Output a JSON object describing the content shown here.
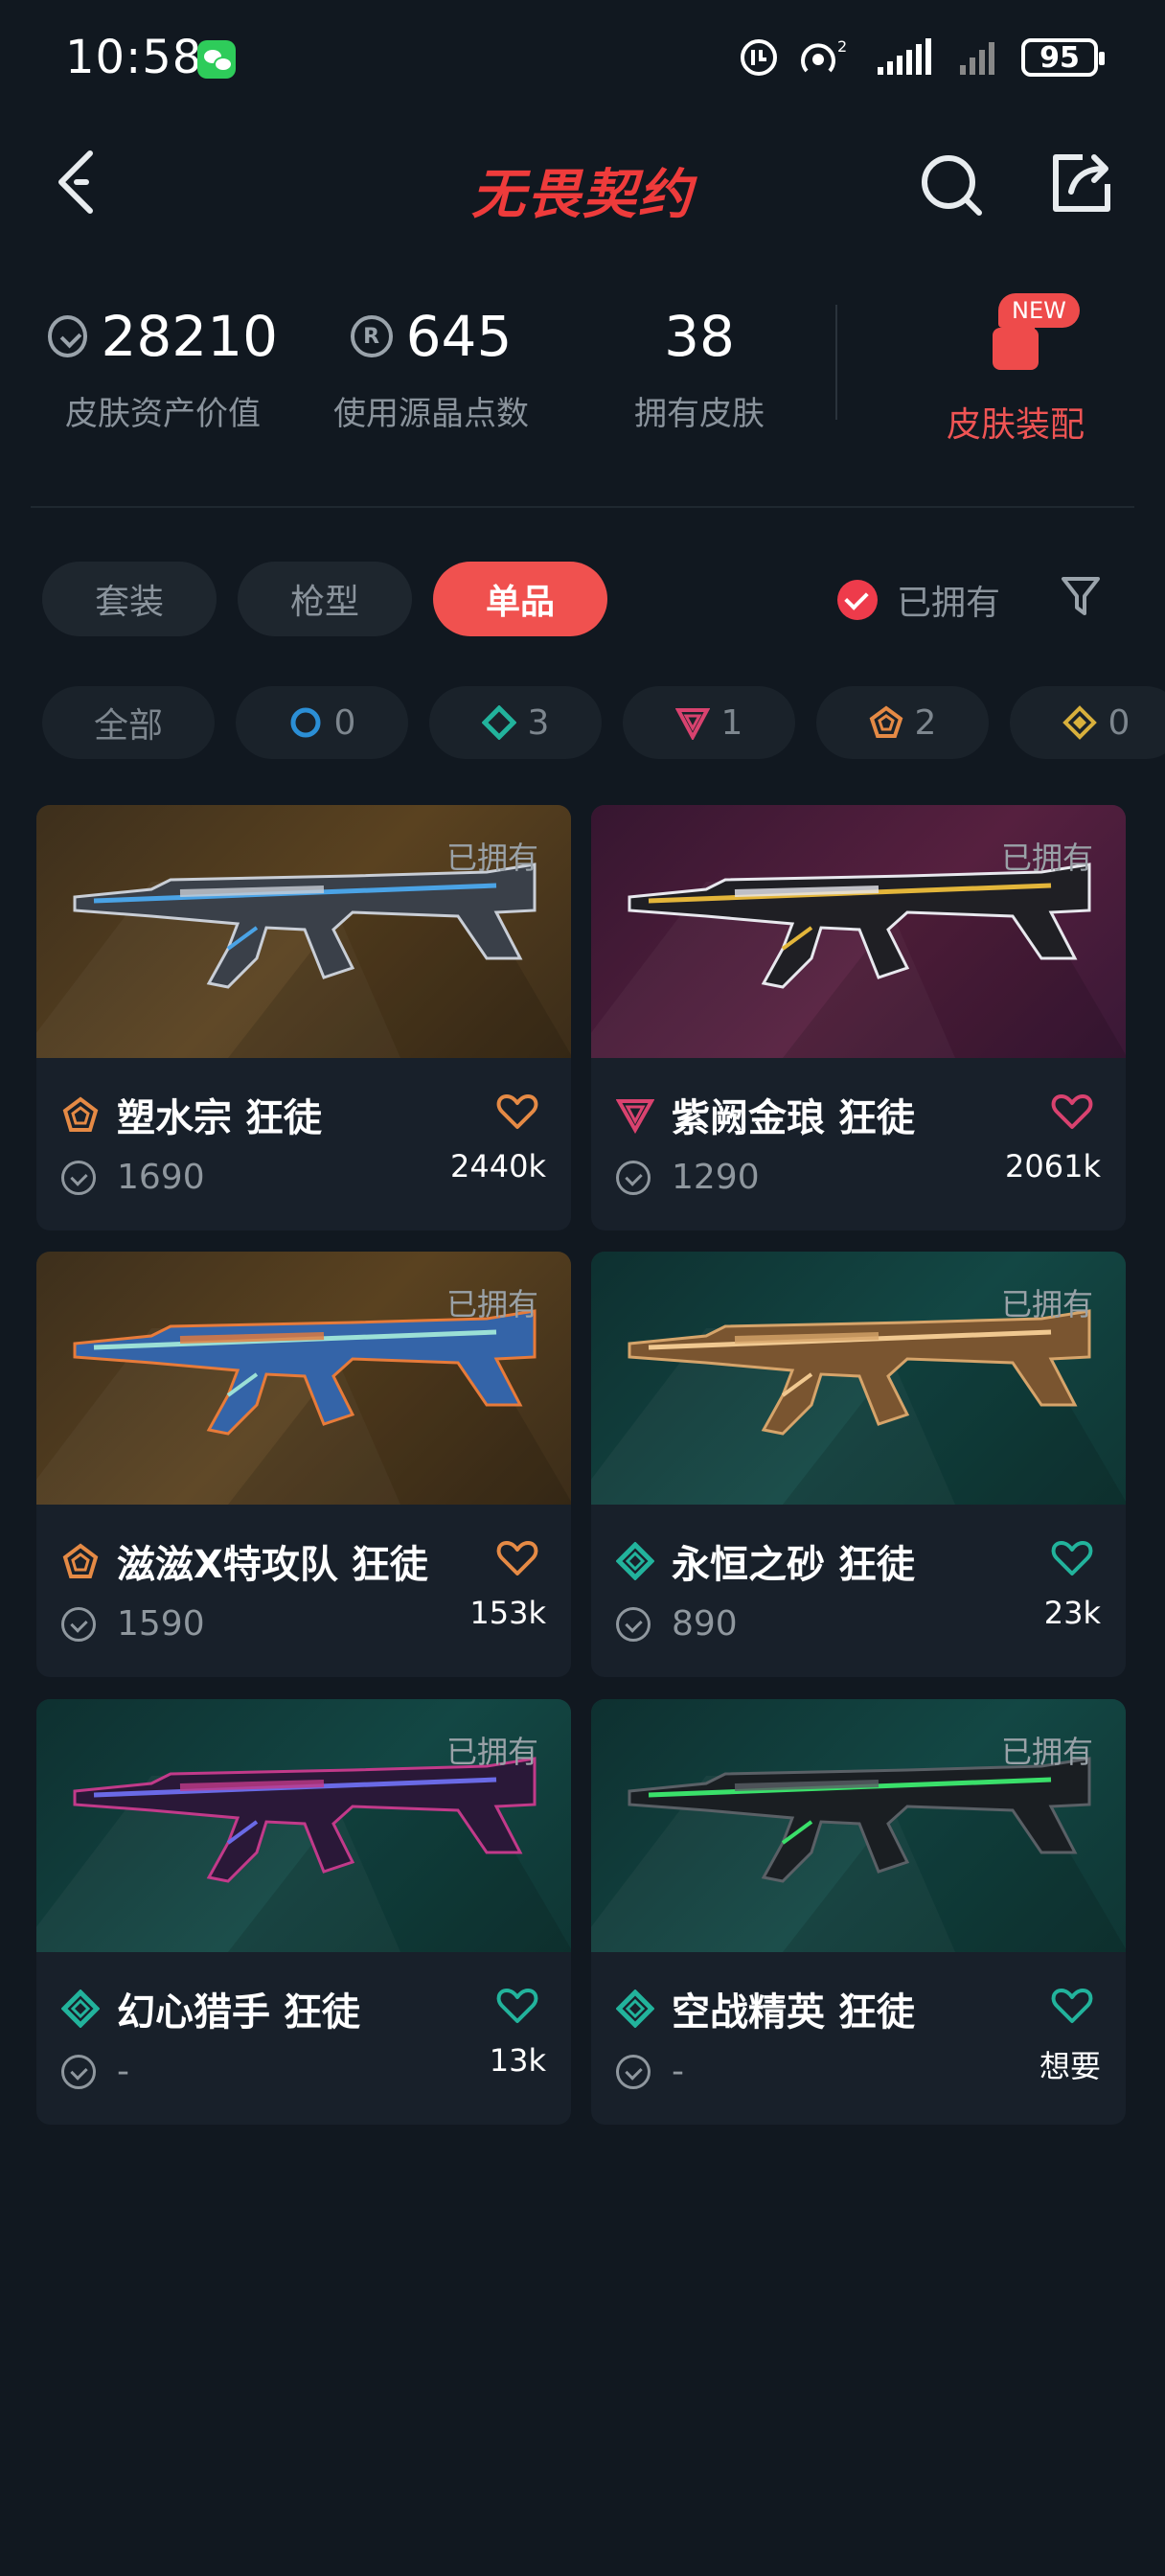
{
  "status_bar": {
    "time": "10:58",
    "battery": "95"
  },
  "header": {
    "title": "无畏契约"
  },
  "stats": [
    {
      "value": "28210",
      "label": "皮肤资产价值",
      "icon": "vp-coin-icon"
    },
    {
      "value": "645",
      "label": "使用源晶点数",
      "icon": "radianite-icon"
    },
    {
      "value": "38",
      "label": "拥有皮肤",
      "icon": ""
    }
  ],
  "loadout": {
    "badge": "NEW",
    "label": "皮肤装配"
  },
  "tabs": [
    {
      "label": "套装",
      "active": false
    },
    {
      "label": "枪型",
      "active": false
    },
    {
      "label": "单品",
      "active": true
    }
  ],
  "owned_filter": {
    "label": "已拥有",
    "checked": true
  },
  "rarity_filters": [
    {
      "label": "全部"
    },
    {
      "count": "0",
      "color": "#2b8fd6",
      "icon": "select-tier-icon"
    },
    {
      "count": "3",
      "color": "#22b39c",
      "icon": "deluxe-tier-icon"
    },
    {
      "count": "1",
      "color": "#d9426f",
      "icon": "premium-tier-icon"
    },
    {
      "count": "2",
      "color": "#e58a45",
      "icon": "exclusive-tier-icon"
    },
    {
      "count": "0",
      "color": "#d8b03c",
      "icon": "ultra-tier-icon"
    }
  ],
  "skins": [
    {
      "name": "塑水宗 狂徒",
      "price": "1690",
      "likes": "2440k",
      "owned": "已拥有",
      "tier": "exclusive",
      "tier_color": "#e58a45",
      "heart_color": "#e58a45",
      "bg": "orange"
    },
    {
      "name": "紫阙金琅 狂徒",
      "price": "1290",
      "likes": "2061k",
      "owned": "已拥有",
      "tier": "premium",
      "tier_color": "#d9426f",
      "heart_color": "#d9426f",
      "bg": "purple"
    },
    {
      "name": "滋滋X特攻队 狂徒",
      "price": "1590",
      "likes": "153k",
      "owned": "已拥有",
      "tier": "exclusive",
      "tier_color": "#e58a45",
      "heart_color": "#e58a45",
      "bg": "orange"
    },
    {
      "name": "永恒之砂 狂徒",
      "price": "890",
      "likes": "23k",
      "owned": "已拥有",
      "tier": "deluxe",
      "tier_color": "#22b39c",
      "heart_color": "#22b39c",
      "bg": "teal"
    },
    {
      "name": "幻心猎手 狂徒",
      "price": "-",
      "likes": "13k",
      "owned": "已拥有",
      "tier": "deluxe",
      "tier_color": "#22b39c",
      "heart_color": "#22b39c",
      "bg": "teal"
    },
    {
      "name": "空战精英 狂徒",
      "price": "-",
      "likes": "想要",
      "owned": "已拥有",
      "tier": "deluxe",
      "tier_color": "#22b39c",
      "heart_color": "#22b39c",
      "bg": "teal"
    }
  ]
}
